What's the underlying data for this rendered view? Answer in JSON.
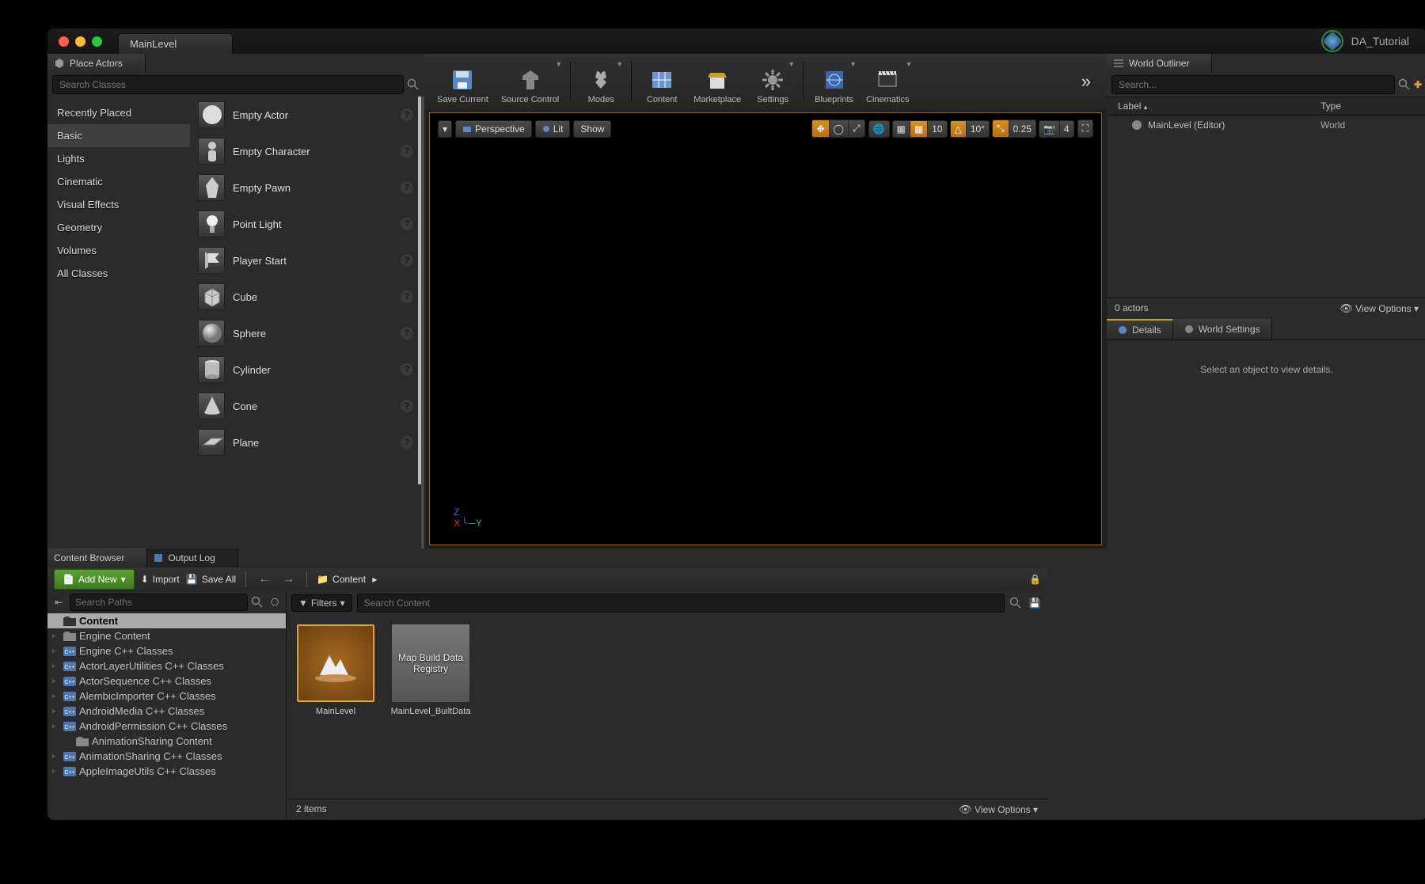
{
  "titlebar": {
    "tab": "MainLevel",
    "project": "DA_Tutorial"
  },
  "placeActors": {
    "title": "Place Actors",
    "search_placeholder": "Search Classes",
    "categories": [
      "Recently Placed",
      "Basic",
      "Lights",
      "Cinematic",
      "Visual Effects",
      "Geometry",
      "Volumes",
      "All Classes"
    ],
    "selected_cat": "Basic",
    "items": [
      "Empty Actor",
      "Empty Character",
      "Empty Pawn",
      "Point Light",
      "Player Start",
      "Cube",
      "Sphere",
      "Cylinder",
      "Cone",
      "Plane"
    ]
  },
  "toolbar": {
    "buttons": [
      {
        "label": "Save Current",
        "caret": false
      },
      {
        "label": "Source Control",
        "caret": true
      },
      {
        "label": "Modes",
        "caret": true,
        "divBefore": true
      },
      {
        "label": "Content",
        "caret": false,
        "divBefore": true
      },
      {
        "label": "Marketplace",
        "caret": false
      },
      {
        "label": "Settings",
        "caret": true
      },
      {
        "label": "Blueprints",
        "caret": true,
        "divBefore": true
      },
      {
        "label": "Cinematics",
        "caret": true
      }
    ]
  },
  "viewport": {
    "menu": "▾",
    "persp": "Perspective",
    "lit": "Lit",
    "show": "Show",
    "snap_t": "10",
    "snap_r": "10°",
    "snap_s": "0.25",
    "cam": "4"
  },
  "outliner": {
    "title": "World Outliner",
    "search_placeholder": "Search...",
    "col1": "Label",
    "col2": "Type",
    "rows": [
      {
        "label": "MainLevel (Editor)",
        "type": "World"
      }
    ],
    "count": "0 actors",
    "viewopt": "View Options"
  },
  "details": {
    "tab1": "Details",
    "tab2": "World Settings",
    "empty": "Select an object to view details."
  },
  "contentBrowser": {
    "tab": "Content Browser",
    "tab2": "Output Log",
    "addnew": "Add New",
    "import": "Import",
    "saveall": "Save All",
    "path": "Content",
    "search_paths": "Search Paths",
    "filters": "Filters",
    "search_content": "Search Content",
    "tree": [
      {
        "label": "Content",
        "sel": true,
        "depth": 0,
        "kind": "folder"
      },
      {
        "label": "Engine Content",
        "depth": 0,
        "kind": "folder",
        "tri": "▹"
      },
      {
        "label": "Engine C++ Classes",
        "depth": 0,
        "kind": "cpp",
        "tri": "▹"
      },
      {
        "label": "ActorLayerUtilities C++ Classes",
        "depth": 0,
        "kind": "cpp",
        "tri": "▹"
      },
      {
        "label": "ActorSequence C++ Classes",
        "depth": 0,
        "kind": "cpp",
        "tri": "▹"
      },
      {
        "label": "AlembicImporter C++ Classes",
        "depth": 0,
        "kind": "cpp",
        "tri": "▹"
      },
      {
        "label": "AndroidMedia C++ Classes",
        "depth": 0,
        "kind": "cpp",
        "tri": "▹"
      },
      {
        "label": "AndroidPermission C++ Classes",
        "depth": 0,
        "kind": "cpp",
        "tri": "▹"
      },
      {
        "label": "AnimationSharing Content",
        "depth": 1,
        "kind": "folder"
      },
      {
        "label": "AnimationSharing C++ Classes",
        "depth": 0,
        "kind": "cpp",
        "tri": "▹"
      },
      {
        "label": "AppleImageUtils C++ Classes",
        "depth": 0,
        "kind": "cpp",
        "tri": "▹"
      }
    ],
    "assets": [
      {
        "name": "MainLevel",
        "sel": true,
        "kind": "level"
      },
      {
        "name": "MainLevel_BuiltData",
        "thumb_text": "Map Build Data Registry"
      }
    ],
    "count": "2 items",
    "viewopt": "View Options"
  }
}
